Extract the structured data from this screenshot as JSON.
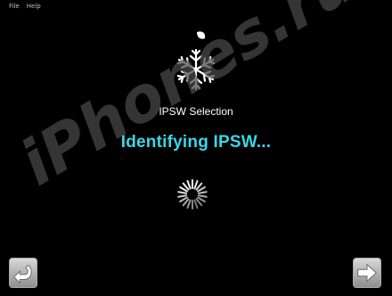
{
  "menu": {
    "file": "File",
    "help": "Help"
  },
  "main": {
    "title": "IPSW Selection",
    "status": "Identifying IPSW..."
  },
  "watermark": "iPhones.ru",
  "icons": {
    "logo": "apple-snowflake-icon",
    "spinner": "loading-spinner-icon",
    "back": "back-arrow-icon",
    "next": "forward-arrow-icon"
  },
  "colors": {
    "background": "#000000",
    "status_text": "#3bd6e6",
    "title_text": "#ffffff"
  }
}
